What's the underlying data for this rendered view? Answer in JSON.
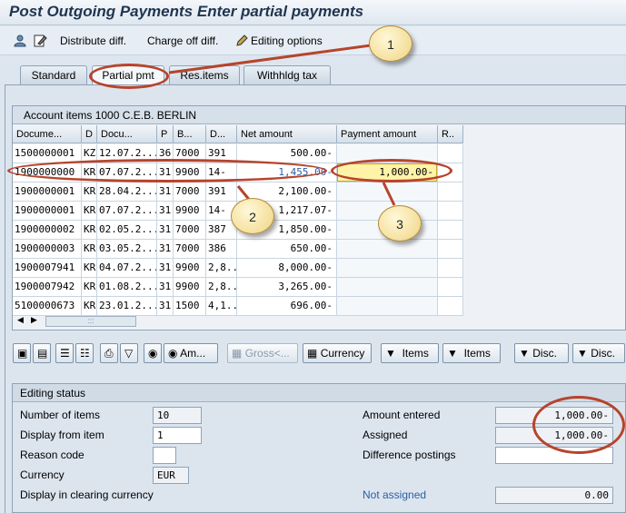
{
  "title": "Post Outgoing Payments Enter partial payments",
  "toolbar": {
    "distribute_label": "Distribute diff.",
    "chargeoff_label": "Charge off diff.",
    "editing_label": "Editing options"
  },
  "tabs": [
    "Standard",
    "Partial pmt",
    "Res.items",
    "Withhldg tax"
  ],
  "grid": {
    "title": "Account items 1000 C.E.B. BERLIN",
    "columns": [
      "Docume...",
      "D",
      "Docu...",
      "P",
      "B...",
      "D...",
      "Net amount",
      "Payment amount",
      "R.."
    ],
    "rows": [
      [
        "1500000001",
        "KZ",
        "12.07.2...",
        "36",
        "7000",
        "391",
        "500.00-",
        ""
      ],
      [
        "1900000000",
        "KR",
        "07.07.2...",
        "31",
        "9900",
        "14-",
        "1,455.00-",
        "1,000.00-"
      ],
      [
        "1900000001",
        "KR",
        "28.04.2...",
        "31",
        "7000",
        "391",
        "2,100.00-",
        ""
      ],
      [
        "1900000001",
        "KR",
        "07.07.2...",
        "31",
        "9900",
        "14-",
        "1,217.07-",
        ""
      ],
      [
        "1900000002",
        "KR",
        "02.05.2...",
        "31",
        "7000",
        "387",
        "1,850.00-",
        ""
      ],
      [
        "1900000003",
        "KR",
        "03.05.2...",
        "31",
        "7000",
        "386",
        "650.00-",
        ""
      ],
      [
        "1900007941",
        "KR",
        "04.07.2...",
        "31",
        "9900",
        "2,8...",
        "8,000.00-",
        ""
      ],
      [
        "1900007942",
        "KR",
        "01.08.2...",
        "31",
        "9900",
        "2,8...",
        "3,265.00-",
        ""
      ],
      [
        "5100000673",
        "KR",
        "23.01.2...",
        "31",
        "1500",
        "4,1...",
        "696.00-",
        ""
      ]
    ],
    "scroll_grip": ":::"
  },
  "buttons": {
    "am": "Am...",
    "gross": "Gross<...",
    "currency": "Currency",
    "items1": "Items",
    "items2": "Items",
    "disc1": "Disc.",
    "disc2": "Disc."
  },
  "status": {
    "title": "Editing status",
    "num_items_label": "Number of items",
    "num_items_value": "10",
    "display_from_label": "Display from item",
    "display_from_value": "1",
    "reason_label": "Reason code",
    "reason_value": "",
    "currency_label": "Currency",
    "currency_value": "EUR",
    "clearing_label": "Display in clearing currency",
    "amount_entered_label": "Amount entered",
    "amount_entered_value": "1,000.00-",
    "assigned_label": "Assigned",
    "assigned_value": "1,000.00-",
    "diff_label": "Difference postings",
    "diff_value": "",
    "not_assigned_label": "Not assigned",
    "not_assigned_value": "0.00"
  },
  "callouts": [
    "1",
    "2",
    "3"
  ],
  "colors": {
    "highlight_field": "#fff3a8",
    "annotation": "#b6442c",
    "link_blue": "#2b5ea7"
  }
}
